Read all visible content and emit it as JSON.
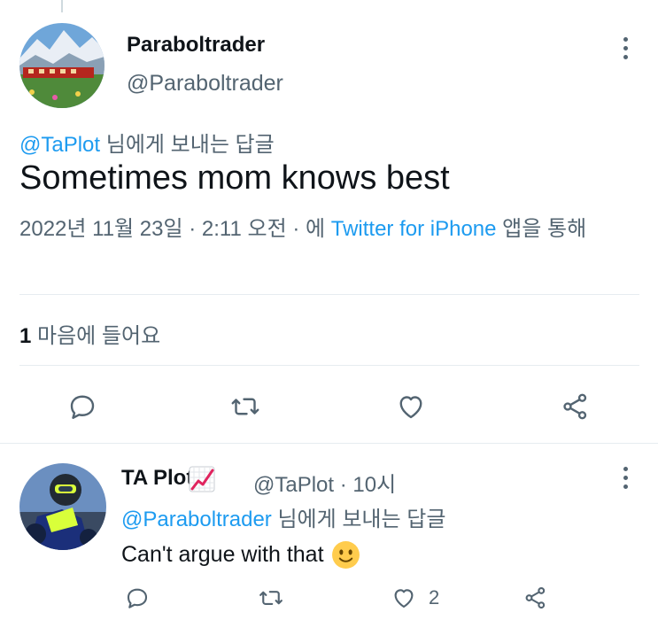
{
  "main_tweet": {
    "author_name": "Paraboltrader",
    "author_handle": "@Paraboltrader",
    "reply_to_handle": "@TaPlot",
    "reply_to_suffix": " 님에게 보내는 답글",
    "text": "Sometimes mom knows best",
    "timestamp": "2022년 11월 23일 · 2:11 오전 · 에 ",
    "source": "Twitter for iPhone",
    "source_suffix": " 앱을 통해",
    "like_count": "1",
    "like_label": " 마음에 들어요",
    "icons": [
      "reply-icon",
      "retweet-icon",
      "like-icon",
      "share-icon"
    ]
  },
  "reply_tweet": {
    "author_name": "TA Plot",
    "badge_icon": "chart-increasing-icon",
    "author_handle": "@TaPlot",
    "time": " · 10시",
    "reply_to_handle": "@Paraboltrader",
    "reply_to_suffix": " 님에게 보내는 답글",
    "text": "Can't argue with that",
    "emoji": "slightly-smiling-face-icon",
    "like_count": "2"
  },
  "colors": {
    "link": "#1d9bf0",
    "secondary_text": "#536471",
    "primary_text": "#0f1419",
    "divider": "#e6ecf0"
  }
}
